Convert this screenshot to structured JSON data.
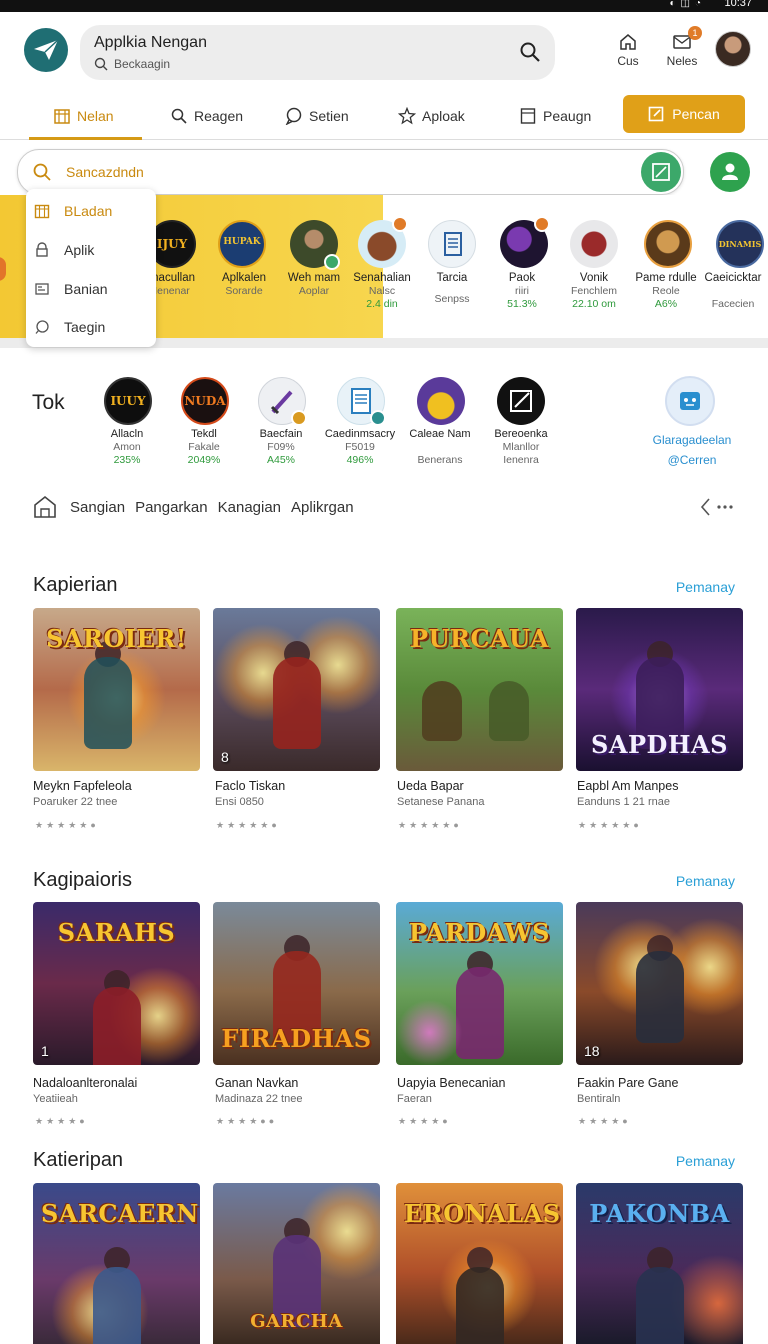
{
  "statusbar": {
    "time": "10:37"
  },
  "header": {
    "app_title": "Applkia Nengan",
    "search_placeholder": "Beckaagin",
    "home_label": "Cus",
    "notif_label": "Neles",
    "notif_badge": "1"
  },
  "tabs": [
    {
      "label": "Nelan",
      "icon": "store-icon"
    },
    {
      "label": "Reagen",
      "icon": "search-icon"
    },
    {
      "label": "Setien",
      "icon": "chat-icon"
    },
    {
      "label": "Aploak",
      "icon": "star-icon"
    },
    {
      "label": "Peaugn",
      "icon": "document-icon"
    }
  ],
  "cta_label": "Pencan",
  "search2": {
    "value": "Sancazdndn"
  },
  "dropdown": [
    {
      "label": "BLadan",
      "icon": "store-icon"
    },
    {
      "label": "Aplik",
      "icon": "lock-icon"
    },
    {
      "label": "Banian",
      "icon": "image-icon"
    },
    {
      "label": "Taegin",
      "icon": "chat-icon"
    }
  ],
  "carousel": [
    {
      "name": "Inacullan",
      "sub": "Ienenar",
      "stat": "",
      "icon_text": "IJUY"
    },
    {
      "name": "Aplkalen",
      "sub": "Sorarde",
      "stat": "",
      "icon_text": "HUPAK"
    },
    {
      "name": "Weh mam",
      "sub": "Aoplar",
      "stat": ""
    },
    {
      "name": "Senahalian",
      "sub": "Nalsc",
      "stat": "2.4 din"
    },
    {
      "name": "Tarcia",
      "sub": "Senpss",
      "stat": ""
    },
    {
      "name": "Paok",
      "sub": "riiri",
      "stat": "51.3%"
    },
    {
      "name": "Vonik",
      "sub": "Fenchlem",
      "stat": "22.10 om"
    },
    {
      "name": "Pame rdulle",
      "sub": "Reole",
      "stat": "A6%"
    },
    {
      "name": "Caeicicktar",
      "sub": "Facecien",
      "stat": "",
      "icon_text": "DINAMIS"
    }
  ],
  "tok": {
    "title": "Tok",
    "items": [
      {
        "name": "Allacln",
        "sub": "Amon",
        "stat": "235%",
        "icon_text": "IUUY"
      },
      {
        "name": "Tekdl",
        "sub": "Fakale",
        "stat": "2049%",
        "icon_text": "NUDA"
      },
      {
        "name": "Baecfain",
        "sub": "F09%",
        "stat": "A45%"
      },
      {
        "name": "Caedinmsacry",
        "sub": "F5019",
        "stat": "496%"
      },
      {
        "name": "Caleae Nam",
        "sub": "Benerans",
        "stat": ""
      },
      {
        "name": "Bereoenka",
        "sub": "Mlanllor",
        "stat": "Ienenra"
      }
    ],
    "side_label1": "Glaragadeelan",
    "side_label2": "@Cerren"
  },
  "categories": [
    "Sangian",
    "Pangarkan",
    "Kanagian",
    "Aplikrgan"
  ],
  "sections": [
    {
      "title": "Kapierian",
      "more": "Pemanay",
      "cards": [
        {
          "name": "Meykn Fapfeleola",
          "sub": "Poaruker 22 tnee",
          "banner": "SAROIER!",
          "num": "",
          "stars": "★★★★★●"
        },
        {
          "name": "Faclo Tiskan",
          "sub": "Ensi 0850",
          "banner": "",
          "num": "8",
          "stars": "★★★★★●"
        },
        {
          "name": "Ueda Bapar",
          "sub": "Setanese Panana",
          "banner": "PURCAUA",
          "num": "",
          "stars": "★★★★★●"
        },
        {
          "name": "Eapbl Am Manpes",
          "sub": "Eanduns 1 21 rnae",
          "banner": "SAPDHAS",
          "num": "",
          "stars": "★★★★★●"
        }
      ]
    },
    {
      "title": "Kagipaioris",
      "more": "Pemanay",
      "cards": [
        {
          "name": "Nadaloanlteronalai",
          "sub": "Yeatiieah",
          "banner": "SARAHS",
          "num": "1",
          "stars": "★★★★●"
        },
        {
          "name": "Ganan Navkan",
          "sub": "Madinaza 22 tnee",
          "banner": "FIRADHAS",
          "num": "",
          "stars": "★★★★●●"
        },
        {
          "name": "Uapyia Benecanian",
          "sub": "Faeran",
          "banner": "PARDAWS",
          "num": "",
          "stars": "★★★★●"
        },
        {
          "name": "Faakin Pare Gane",
          "sub": "Bentiraln",
          "banner": "",
          "num": "18",
          "stars": "★★★★●"
        }
      ]
    },
    {
      "title": "Katieripan",
      "more": "Pemanay",
      "cards": [
        {
          "name": "",
          "sub": "",
          "banner": "SARCAERN",
          "num": "",
          "stars": ""
        },
        {
          "name": "",
          "sub": "",
          "banner": "GARCHA",
          "num": "",
          "stars": ""
        },
        {
          "name": "",
          "sub": "",
          "banner": "ERONALAS",
          "num": "",
          "stars": ""
        },
        {
          "name": "",
          "sub": "",
          "banner": "PAKONBA",
          "num": "",
          "stars": ""
        }
      ]
    }
  ],
  "colors": {
    "accent": "#e0a018",
    "accent_text": "#c98a10",
    "link": "#2a9fd6",
    "green": "#2f9a3c",
    "yellow_band": "#f3c833"
  }
}
